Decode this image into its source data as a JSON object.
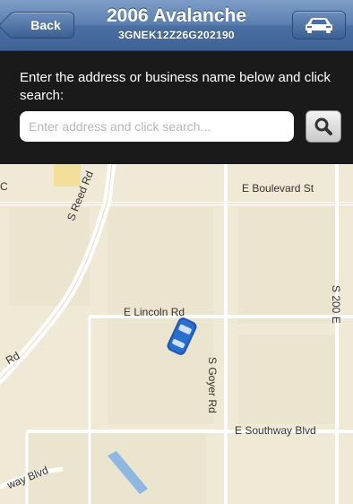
{
  "navbar": {
    "back_label": "Back",
    "title": "2006 Avalanche",
    "subtitle": "3GNEK12Z26G202190",
    "car_button_icon": "car-icon"
  },
  "search": {
    "instructions": "Enter the address or business name below and click search:",
    "placeholder": "Enter address and click search...",
    "value": "",
    "button_icon": "magnifier-icon"
  },
  "map": {
    "streets": {
      "e_boulevard": "E Boulevard St",
      "s_reed": "S Reed Rd",
      "e_lincoln": "E Lincoln Rd",
      "s_200_e": "S 200 E",
      "s_goyer": "S Goyer Rd",
      "e_southway": "E Southway Blvd",
      "rd_left": "Rd",
      "way_blvd": "way Blvd",
      "c_edge": "C"
    },
    "vehicle_marker_icon": "car-marker-icon"
  },
  "colors": {
    "nav_blue": "#4a6fa2",
    "map_base": "#efe9d6",
    "water": "#8fb8e0",
    "vehicle": "#2a6fd0"
  }
}
